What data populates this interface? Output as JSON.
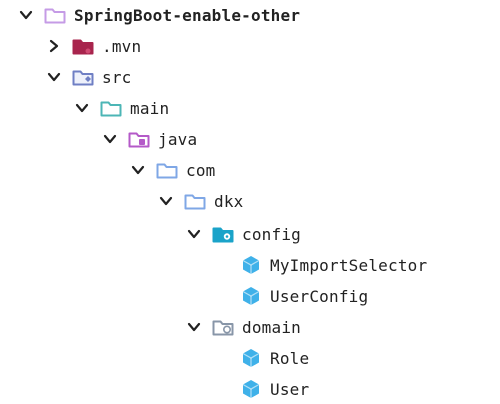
{
  "tree": {
    "root": {
      "label": "SpringBoot-enable-other",
      "expanded": true,
      "icon": "project-folder-icon",
      "color": "#c59be6"
    },
    "nodes": [
      {
        "label": ".mvn",
        "expanded": false,
        "icon": "folder-icon",
        "color": "#a8244d"
      },
      {
        "label": "src",
        "expanded": true,
        "icon": "source-folder-icon",
        "color": "#6f7fc4"
      },
      {
        "label": "main",
        "expanded": true,
        "icon": "folder-icon",
        "color": "#4cb6b6"
      },
      {
        "label": "java",
        "expanded": true,
        "icon": "folder-icon",
        "color": "#b45ac8"
      },
      {
        "label": "com",
        "expanded": true,
        "icon": "package-folder-icon",
        "color": "#7fa7e6"
      },
      {
        "label": "dkx",
        "expanded": true,
        "icon": "package-folder-icon",
        "color": "#7fa7e6"
      },
      {
        "label": "config",
        "expanded": true,
        "icon": "config-folder-icon",
        "color": "#1aa3c9"
      },
      {
        "label": "MyImportSelector",
        "icon": "java-class-icon",
        "color": "#3fb1e9"
      },
      {
        "label": "UserConfig",
        "icon": "java-class-icon",
        "color": "#3fb1e9"
      },
      {
        "label": "domain",
        "expanded": true,
        "icon": "domain-folder-icon",
        "color": "#8896a8"
      },
      {
        "label": "Role",
        "icon": "java-class-icon",
        "color": "#3fb1e9"
      },
      {
        "label": "User",
        "icon": "java-class-icon",
        "color": "#3fb1e9"
      }
    ]
  }
}
